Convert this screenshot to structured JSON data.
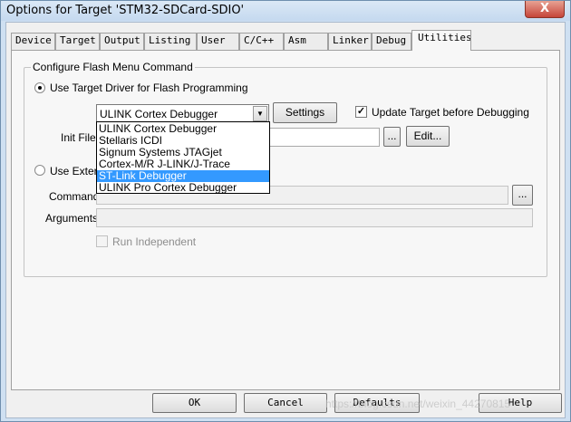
{
  "window": {
    "title": "Options for Target 'STM32-SDCard-SDIO'",
    "close": "X"
  },
  "tabs": [
    "Device",
    "Target",
    "Output",
    "Listing",
    "User",
    "C/C++",
    "Asm",
    "Linker",
    "Debug",
    "Utilities"
  ],
  "active_tab": "Utilities",
  "group": {
    "title": "Configure Flash Menu Command",
    "use_target_driver": {
      "label": "Use Target Driver for Flash Programming",
      "checked": true
    },
    "driver_select": {
      "value": "ULINK Cortex Debugger"
    },
    "settings_button": "Settings",
    "update_target": {
      "label": "Update Target before Debugging",
      "checked": true
    },
    "init_file_label": "Init File:",
    "browse_label": "...",
    "edit_button": "Edit...",
    "use_external": {
      "label": "Use External Tool for Flash Programming",
      "visible_label": "Use Extern",
      "checked": false
    },
    "command_label": "Command:",
    "command_browse": "...",
    "arguments_label": "Arguments:",
    "run_independent": {
      "label": "Run Independent",
      "checked": false
    }
  },
  "dropdown": {
    "options": [
      "ULINK Cortex Debugger",
      "Stellaris ICDI",
      "Signum Systems JTAGjet",
      "Cortex-M/R J-LINK/J-Trace",
      "ST-Link Debugger",
      "ULINK Pro Cortex Debugger"
    ],
    "selected": "ST-Link Debugger"
  },
  "buttons": {
    "ok": "OK",
    "cancel": "Cancel",
    "defaults": "Defaults",
    "help": "Help"
  },
  "watermark": "https://blog.csdn.net/weixin_44270815"
}
